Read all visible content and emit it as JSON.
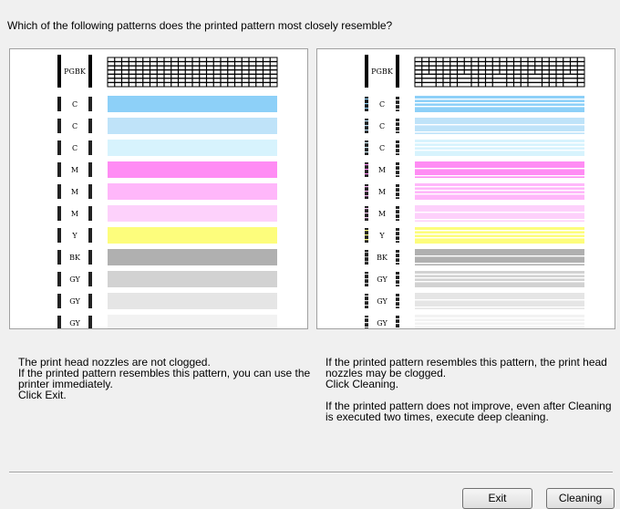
{
  "dialog": {
    "question": "Which of the following patterns does the printed pattern most closely resemble?"
  },
  "patterns": {
    "head_label": "PGBK",
    "rows": [
      {
        "label": "C",
        "color": "#8dd0f8"
      },
      {
        "label": "C",
        "color": "#bfe3f9"
      },
      {
        "label": "C",
        "color": "#d7f3fd"
      },
      {
        "label": "M",
        "color": "#ff8cf4"
      },
      {
        "label": "M",
        "color": "#ffb7fa"
      },
      {
        "label": "M",
        "color": "#fdd1fb"
      },
      {
        "label": "Y",
        "color": "#fdfd7c"
      },
      {
        "label": "BK",
        "color": "#b0b0b0"
      },
      {
        "label": "GY",
        "color": "#d2d2d2"
      },
      {
        "label": "GY",
        "color": "#e5e5e5"
      },
      {
        "label": "GY",
        "color": "#f2f2f2"
      }
    ]
  },
  "left_description": [
    "The print head nozzles are not clogged.",
    "If the printed pattern resembles this pattern, you can use the printer immediately.",
    "Click Exit."
  ],
  "right_description": {
    "para1": "If the printed pattern resembles this pattern, the print head nozzles may be clogged.",
    "para1b": "Click Cleaning.",
    "para2": "If the printed pattern does not improve, even after Cleaning is executed two times, execute deep cleaning."
  },
  "buttons": {
    "exit": "Exit",
    "cleaning": "Cleaning"
  }
}
